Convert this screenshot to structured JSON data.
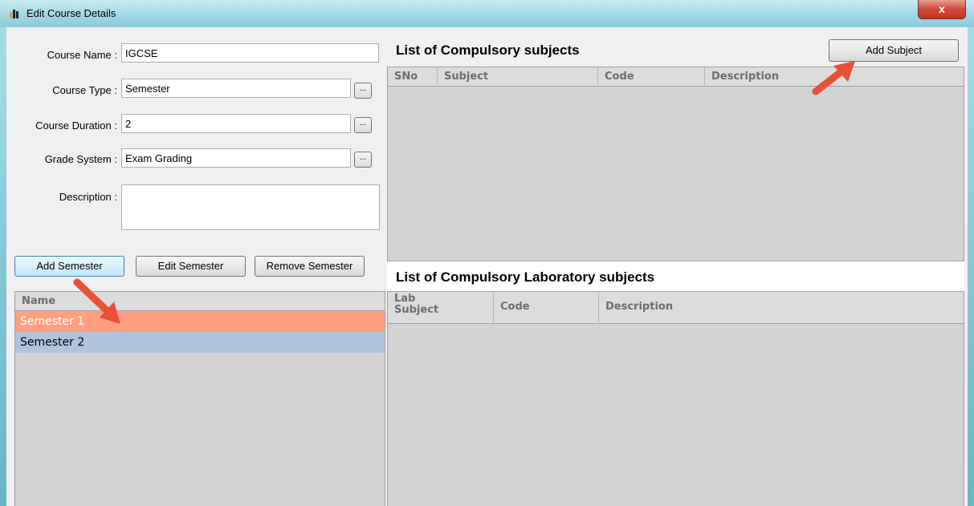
{
  "window": {
    "title": "Edit Course Details",
    "close_label": "x"
  },
  "form": {
    "course_name": {
      "label": "Course Name :",
      "value": "IGCSE"
    },
    "course_type": {
      "label": "Course Type :",
      "value": "Semester"
    },
    "course_duration": {
      "label": "Course Duration :",
      "value": "2"
    },
    "grade_system": {
      "label": "Grade System :",
      "value": "Exam Grading"
    },
    "description": {
      "label": "Description :",
      "value": ""
    },
    "browse_label": "..."
  },
  "semester_buttons": {
    "add": "Add Semester",
    "edit": "Edit Semester",
    "remove": "Remove Semester"
  },
  "semester_grid": {
    "header": "Name",
    "rows": [
      "Semester 1",
      "Semester 2"
    ],
    "selected_color": "#ff9f80",
    "alt_color": "#b0c4de"
  },
  "compulsory": {
    "title": "List of Compulsory subjects",
    "add_button": "Add Subject",
    "columns": [
      "SNo",
      "Subject",
      "Code",
      "Description"
    ]
  },
  "lab": {
    "title": "List of Compulsory Laboratory subjects",
    "columns": [
      "Lab\nSubject",
      "Code",
      "Description"
    ]
  },
  "colors": {
    "arrow": "#e8503a",
    "grid_bg": "#d3d3d3"
  }
}
